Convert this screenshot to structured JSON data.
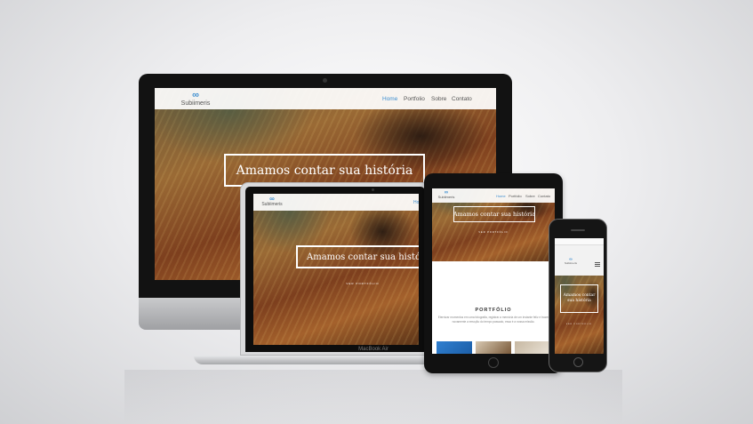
{
  "site": {
    "logo_text": "Subiimeris",
    "nav": [
      "Home",
      "Portfolio",
      "Sobre",
      "Contato"
    ],
    "hero_title": "Amamos contar sua história",
    "hero_sub": "VER PORTFÓLIO",
    "section_title": "PORTFÓLIO",
    "section_text": "Eternizar momentos em uma fotografia, registrar a memória de um instante feliz e trazer novamente a emoção do tempo passado, essa é a nossa missão."
  },
  "devices": {
    "laptop_label": "MacBook Air"
  },
  "colors": {
    "accent": "#3f8fd0",
    "device_dark": "#121212",
    "aluminum": "#c9cacc"
  },
  "icons": {
    "logo": "infinity-icon",
    "menu": "hamburger-menu-icon"
  }
}
